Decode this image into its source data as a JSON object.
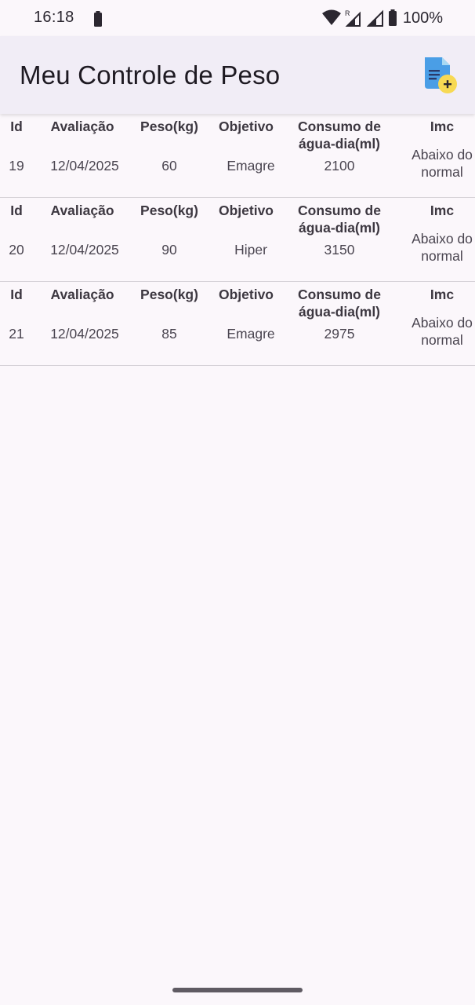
{
  "status_bar": {
    "time": "16:18",
    "battery_percent": "100%",
    "roaming_indicator": "R",
    "icons": [
      "battery-icon",
      "wifi-icon",
      "signal-roaming-icon",
      "signal-icon",
      "battery-icon"
    ]
  },
  "app_bar": {
    "title": "Meu Controle de Peso",
    "action_icon": "add-document-icon"
  },
  "table_headers": {
    "id": "Id",
    "avaliacao": "Avaliação",
    "peso": "Peso(kg)",
    "objetivo": "Objetivo",
    "consumo": "Consumo de água-dia(ml)",
    "imc": "Imc"
  },
  "records": [
    {
      "id": "19",
      "avaliacao": "12/04/2025",
      "peso": "60",
      "objetivo": "Emagre",
      "consumo": "2100",
      "imc": "Abaixo do normal"
    },
    {
      "id": "20",
      "avaliacao": "12/04/2025",
      "peso": "90",
      "objetivo": "Hiper",
      "consumo": "3150",
      "imc": "Abaixo do normal"
    },
    {
      "id": "21",
      "avaliacao": "12/04/2025",
      "peso": "85",
      "objetivo": "Emagre",
      "consumo": "2975",
      "imc": "Abaixo do normal"
    }
  ],
  "colors": {
    "background": "#fbf7fb",
    "app_bar": "#f1edf6",
    "icon_blue": "#4a9ee6",
    "icon_yellow": "#f7d953",
    "divider": "#d6d2d8"
  }
}
